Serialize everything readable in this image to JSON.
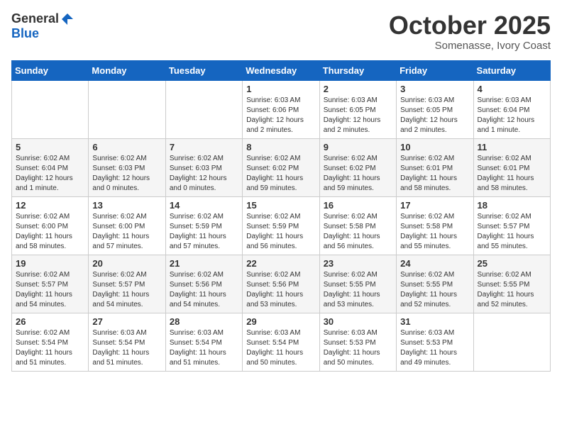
{
  "header": {
    "logo_general": "General",
    "logo_blue": "Blue",
    "month": "October 2025",
    "location": "Somenasse, Ivory Coast"
  },
  "weekdays": [
    "Sunday",
    "Monday",
    "Tuesday",
    "Wednesday",
    "Thursday",
    "Friday",
    "Saturday"
  ],
  "weeks": [
    [
      {
        "day": "",
        "info": ""
      },
      {
        "day": "",
        "info": ""
      },
      {
        "day": "",
        "info": ""
      },
      {
        "day": "1",
        "info": "Sunrise: 6:03 AM\nSunset: 6:06 PM\nDaylight: 12 hours\nand 2 minutes."
      },
      {
        "day": "2",
        "info": "Sunrise: 6:03 AM\nSunset: 6:05 PM\nDaylight: 12 hours\nand 2 minutes."
      },
      {
        "day": "3",
        "info": "Sunrise: 6:03 AM\nSunset: 6:05 PM\nDaylight: 12 hours\nand 2 minutes."
      },
      {
        "day": "4",
        "info": "Sunrise: 6:03 AM\nSunset: 6:04 PM\nDaylight: 12 hours\nand 1 minute."
      }
    ],
    [
      {
        "day": "5",
        "info": "Sunrise: 6:02 AM\nSunset: 6:04 PM\nDaylight: 12 hours\nand 1 minute."
      },
      {
        "day": "6",
        "info": "Sunrise: 6:02 AM\nSunset: 6:03 PM\nDaylight: 12 hours\nand 0 minutes."
      },
      {
        "day": "7",
        "info": "Sunrise: 6:02 AM\nSunset: 6:03 PM\nDaylight: 12 hours\nand 0 minutes."
      },
      {
        "day": "8",
        "info": "Sunrise: 6:02 AM\nSunset: 6:02 PM\nDaylight: 11 hours\nand 59 minutes."
      },
      {
        "day": "9",
        "info": "Sunrise: 6:02 AM\nSunset: 6:02 PM\nDaylight: 11 hours\nand 59 minutes."
      },
      {
        "day": "10",
        "info": "Sunrise: 6:02 AM\nSunset: 6:01 PM\nDaylight: 11 hours\nand 58 minutes."
      },
      {
        "day": "11",
        "info": "Sunrise: 6:02 AM\nSunset: 6:01 PM\nDaylight: 11 hours\nand 58 minutes."
      }
    ],
    [
      {
        "day": "12",
        "info": "Sunrise: 6:02 AM\nSunset: 6:00 PM\nDaylight: 11 hours\nand 58 minutes."
      },
      {
        "day": "13",
        "info": "Sunrise: 6:02 AM\nSunset: 6:00 PM\nDaylight: 11 hours\nand 57 minutes."
      },
      {
        "day": "14",
        "info": "Sunrise: 6:02 AM\nSunset: 5:59 PM\nDaylight: 11 hours\nand 57 minutes."
      },
      {
        "day": "15",
        "info": "Sunrise: 6:02 AM\nSunset: 5:59 PM\nDaylight: 11 hours\nand 56 minutes."
      },
      {
        "day": "16",
        "info": "Sunrise: 6:02 AM\nSunset: 5:58 PM\nDaylight: 11 hours\nand 56 minutes."
      },
      {
        "day": "17",
        "info": "Sunrise: 6:02 AM\nSunset: 5:58 PM\nDaylight: 11 hours\nand 55 minutes."
      },
      {
        "day": "18",
        "info": "Sunrise: 6:02 AM\nSunset: 5:57 PM\nDaylight: 11 hours\nand 55 minutes."
      }
    ],
    [
      {
        "day": "19",
        "info": "Sunrise: 6:02 AM\nSunset: 5:57 PM\nDaylight: 11 hours\nand 54 minutes."
      },
      {
        "day": "20",
        "info": "Sunrise: 6:02 AM\nSunset: 5:57 PM\nDaylight: 11 hours\nand 54 minutes."
      },
      {
        "day": "21",
        "info": "Sunrise: 6:02 AM\nSunset: 5:56 PM\nDaylight: 11 hours\nand 54 minutes."
      },
      {
        "day": "22",
        "info": "Sunrise: 6:02 AM\nSunset: 5:56 PM\nDaylight: 11 hours\nand 53 minutes."
      },
      {
        "day": "23",
        "info": "Sunrise: 6:02 AM\nSunset: 5:55 PM\nDaylight: 11 hours\nand 53 minutes."
      },
      {
        "day": "24",
        "info": "Sunrise: 6:02 AM\nSunset: 5:55 PM\nDaylight: 11 hours\nand 52 minutes."
      },
      {
        "day": "25",
        "info": "Sunrise: 6:02 AM\nSunset: 5:55 PM\nDaylight: 11 hours\nand 52 minutes."
      }
    ],
    [
      {
        "day": "26",
        "info": "Sunrise: 6:02 AM\nSunset: 5:54 PM\nDaylight: 11 hours\nand 51 minutes."
      },
      {
        "day": "27",
        "info": "Sunrise: 6:03 AM\nSunset: 5:54 PM\nDaylight: 11 hours\nand 51 minutes."
      },
      {
        "day": "28",
        "info": "Sunrise: 6:03 AM\nSunset: 5:54 PM\nDaylight: 11 hours\nand 51 minutes."
      },
      {
        "day": "29",
        "info": "Sunrise: 6:03 AM\nSunset: 5:54 PM\nDaylight: 11 hours\nand 50 minutes."
      },
      {
        "day": "30",
        "info": "Sunrise: 6:03 AM\nSunset: 5:53 PM\nDaylight: 11 hours\nand 50 minutes."
      },
      {
        "day": "31",
        "info": "Sunrise: 6:03 AM\nSunset: 5:53 PM\nDaylight: 11 hours\nand 49 minutes."
      },
      {
        "day": "",
        "info": ""
      }
    ]
  ]
}
